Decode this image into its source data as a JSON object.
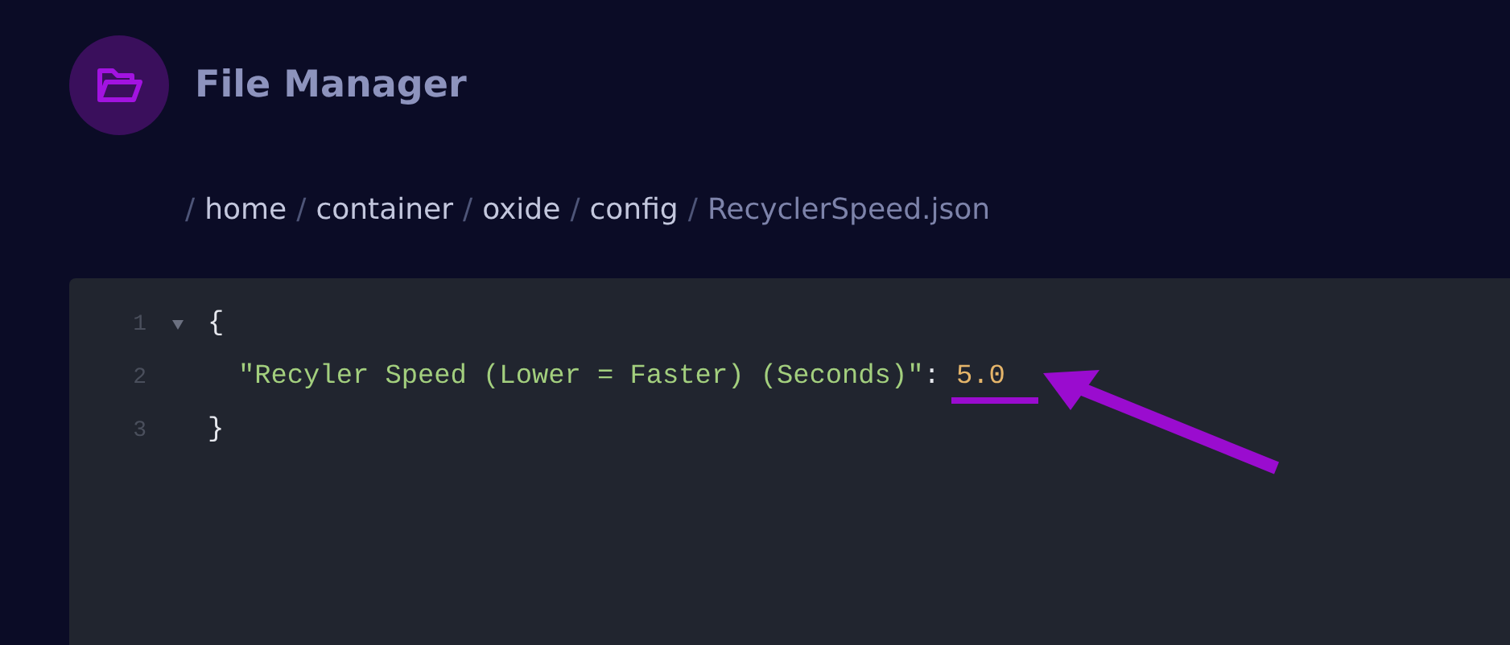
{
  "header": {
    "title": "File Manager"
  },
  "breadcrumb": [
    {
      "separator": "/",
      "label": "home",
      "current": false
    },
    {
      "separator": "/",
      "label": "container",
      "current": false
    },
    {
      "separator": "/",
      "label": "oxide",
      "current": false
    },
    {
      "separator": "/",
      "label": "config",
      "current": false
    },
    {
      "separator": "/",
      "label": "RecyclerSpeed.json",
      "current": true
    }
  ],
  "editor": {
    "lines": [
      {
        "number": "1",
        "expanded": true,
        "tokens": [
          {
            "kind": "punct",
            "text": "{"
          }
        ],
        "children": [
          {
            "number": "2",
            "tokens": [
              {
                "kind": "key",
                "text": "\"Recyler Speed (Lower = Faster) (Seconds)\""
              },
              {
                "kind": "punct",
                "text": ": "
              },
              {
                "kind": "number",
                "text": "5.0"
              }
            ]
          }
        ]
      },
      {
        "number": "3",
        "tokens": [
          {
            "kind": "punct",
            "text": "}"
          }
        ]
      }
    ]
  }
}
